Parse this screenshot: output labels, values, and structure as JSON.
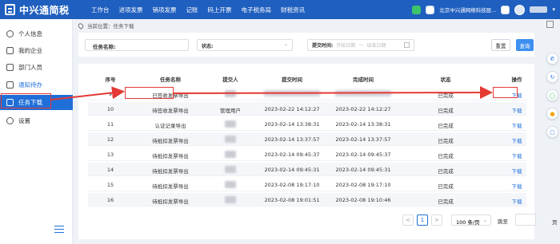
{
  "app": {
    "title": "中兴通简税",
    "nav": [
      "工作台",
      "进项发票",
      "销项发票",
      "记账",
      "码上开票",
      "电子税务局",
      "财税资讯"
    ],
    "company": "北京中兴通网络科技股...",
    "colors": {
      "brand": "#1f5fbf",
      "accent": "#1f6fd9",
      "annotation": "#e53935"
    }
  },
  "sidebar": {
    "items": [
      {
        "label": "个人信息",
        "icon": "user-icon"
      },
      {
        "label": "我的企业",
        "icon": "building-icon"
      },
      {
        "label": "部门人员",
        "icon": "people-icon"
      },
      {
        "label": "通知待办",
        "icon": "bell-icon"
      },
      {
        "label": "任务下载",
        "icon": "download-icon"
      },
      {
        "label": "设置",
        "icon": "gear-icon"
      }
    ]
  },
  "breadcrumb": {
    "text": "当前位置：任务下载"
  },
  "filter": {
    "name_label": "任务名称:",
    "status_label": "状态:",
    "time_label": "提交时间:",
    "start_placeholder": "开始日期",
    "separator": "一",
    "end_placeholder": "结束日期",
    "reset_label": "重置",
    "query_label": "查询"
  },
  "table": {
    "headers": [
      "序号",
      "任务名称",
      "提交人",
      "提交时间",
      "完成时间",
      "状态",
      "操作"
    ],
    "rows": [
      {
        "seq": "9",
        "name": "已签收发票导出",
        "submitter": "",
        "submit_time": "",
        "finish_time": "",
        "status": "已完成",
        "action": "下载"
      },
      {
        "seq": "10",
        "name": "待签收发票导出",
        "submitter": "管理用户",
        "submit_time": "2023-02-22 14:12:27",
        "finish_time": "2023-02-22 14:12:27",
        "status": "已完成",
        "action": "下载"
      },
      {
        "seq": "11",
        "name": "认证记录导出",
        "submitter": "",
        "submit_time": "2023-02-14 13:38:31",
        "finish_time": "2023-02-14 13:38:31",
        "status": "已完成",
        "action": "下载"
      },
      {
        "seq": "12",
        "name": "待抵扣发票导出",
        "submitter": "",
        "submit_time": "2023-02-14 13:37:57",
        "finish_time": "2023-02-14 13:37:57",
        "status": "已完成",
        "action": "下载"
      },
      {
        "seq": "13",
        "name": "待抵扣发票导出",
        "submitter": "",
        "submit_time": "2023-02-14 09:45:37",
        "finish_time": "2023-02-14 09:45:37",
        "status": "已完成",
        "action": "下载"
      },
      {
        "seq": "14",
        "name": "待抵扣发票导出",
        "submitter": "",
        "submit_time": "2023-02-14 09:45:31",
        "finish_time": "2023-02-14 09:45:31",
        "status": "已完成",
        "action": "下载"
      },
      {
        "seq": "15",
        "name": "待抵扣发票导出",
        "submitter": "",
        "submit_time": "2023-02-08 19:17:10",
        "finish_time": "2023-02-08 19:17:10",
        "status": "已完成",
        "action": "下载"
      },
      {
        "seq": "16",
        "name": "待抵扣发票导出",
        "submitter": "",
        "submit_time": "2023-02-08 19:01:51",
        "finish_time": "2023-02-08 19:10:46",
        "status": "已完成",
        "action": "下载"
      }
    ]
  },
  "pagination": {
    "prev": "<",
    "current_page": "1",
    "next": ">",
    "page_size": "100 条/页",
    "goto_label": "跳至",
    "page_suffix": "页"
  }
}
